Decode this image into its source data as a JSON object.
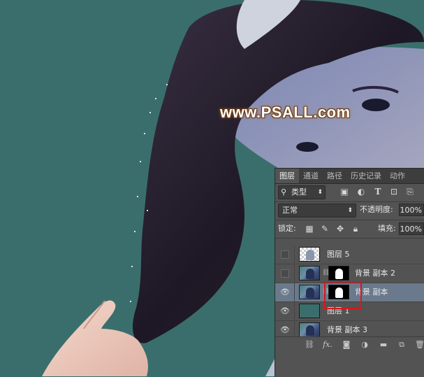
{
  "canvas": {
    "watermark": "www.PSALL.com",
    "background_color": "#3a6e6c"
  },
  "layers_panel": {
    "tabs": [
      {
        "label": "图层",
        "active": true
      },
      {
        "label": "通道",
        "active": false
      },
      {
        "label": "路径",
        "active": false
      },
      {
        "label": "历史记录",
        "active": false
      },
      {
        "label": "动作",
        "active": false
      }
    ],
    "filter": {
      "kind_label": "类型",
      "icons": [
        "image-filter-icon",
        "adjustment-filter-icon",
        "text-filter-icon",
        "shape-filter-icon",
        "smart-object-filter-icon"
      ]
    },
    "blend_mode": "正常",
    "opacity_label": "不透明度:",
    "opacity_value": "100%",
    "lock_label": "锁定:",
    "lock_icons": [
      "lock-transparent-icon",
      "lock-pixels-icon",
      "lock-position-icon",
      "lock-all-icon"
    ],
    "fill_label": "填充:",
    "fill_value": "100%",
    "layers": [
      {
        "name": "图层 5",
        "visible": false,
        "thumb": "checker",
        "mask": false,
        "selected": false
      },
      {
        "name": "背景 副本 2",
        "visible": false,
        "thumb": "photo",
        "mask": true,
        "selected": false
      },
      {
        "name": "背景 副本",
        "visible": true,
        "thumb": "photo",
        "mask": true,
        "selected": true
      },
      {
        "name": "图层 1",
        "visible": true,
        "thumb": "teal",
        "mask": false,
        "selected": false
      },
      {
        "name": "背景 副本 3",
        "visible": true,
        "thumb": "photo",
        "mask": false,
        "selected": false
      }
    ],
    "bottom_icons": [
      "link-layers-icon",
      "fx-icon",
      "add-mask-icon",
      "adjustment-layer-icon",
      "new-group-icon",
      "new-layer-icon",
      "delete-layer-icon"
    ],
    "fx_label": "fx."
  },
  "colors": {
    "panel_bg": "#535353",
    "selected_row": "#6a7a8c",
    "highlight_box": "#d9161c"
  }
}
